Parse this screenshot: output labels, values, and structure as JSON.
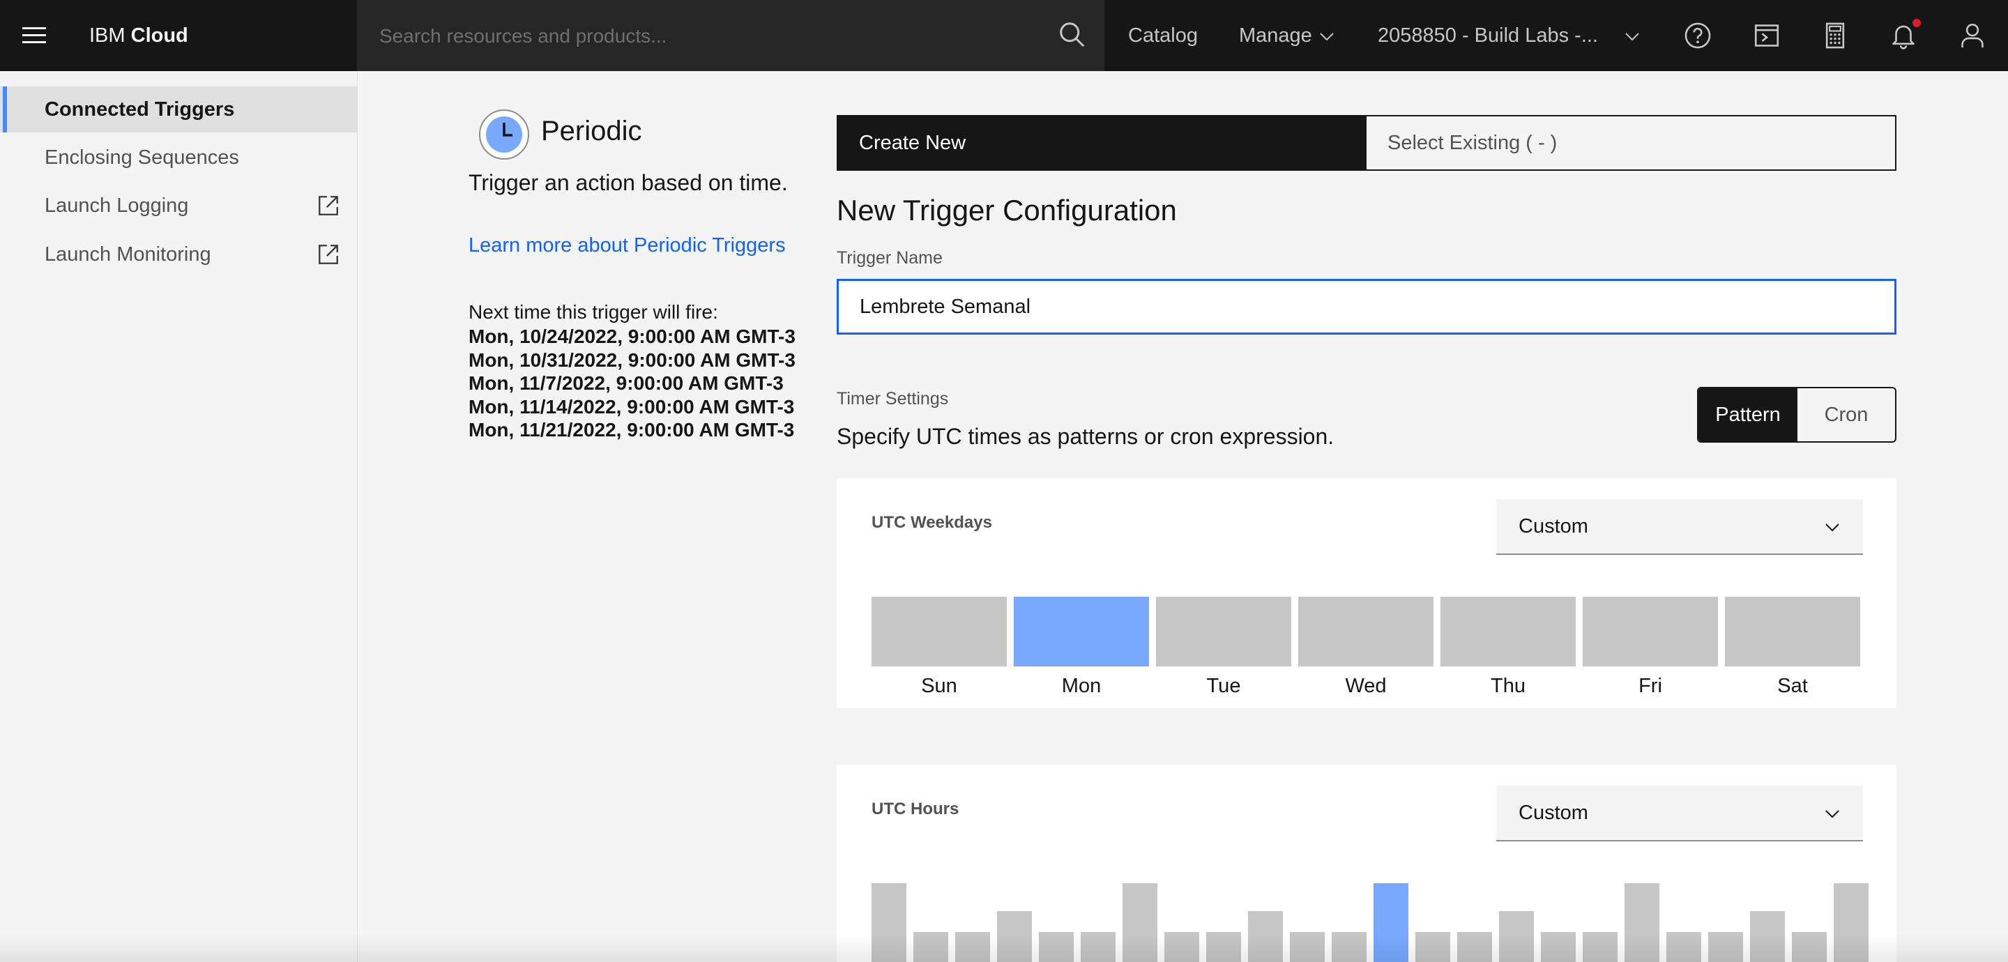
{
  "header": {
    "brand_prefix": "IBM",
    "brand_name": "Cloud",
    "search_placeholder": "Search resources and products...",
    "catalog_label": "Catalog",
    "manage_label": "Manage",
    "account_label": "2058850 - Build Labs -...",
    "icons": [
      "menu-icon",
      "search-icon",
      "chevron-down-icon",
      "help-icon",
      "cloud-shell-icon",
      "cost-estimator-icon",
      "notification-icon",
      "user-icon"
    ]
  },
  "sidebar": {
    "items": [
      {
        "label": "Connected Triggers",
        "active": true
      },
      {
        "label": "Enclosing Sequences"
      },
      {
        "label": "Launch Logging",
        "icon": "launch-icon"
      },
      {
        "label": "Launch Monitoring",
        "icon": "launch-icon"
      }
    ]
  },
  "trigger_info": {
    "title": "Periodic",
    "description": "Trigger an action based on time.",
    "learn_more": "Learn more about Periodic Triggers",
    "next_fire_label": "Next time this trigger will fire:",
    "next_fire_times": [
      "Mon, 10/24/2022, 9:00:00 AM GMT-3",
      "Mon, 10/31/2022, 9:00:00 AM GMT-3",
      "Mon, 11/7/2022, 9:00:00 AM GMT-3",
      "Mon, 11/14/2022, 9:00:00 AM GMT-3",
      "Mon, 11/21/2022, 9:00:00 AM GMT-3"
    ]
  },
  "config": {
    "tabs": [
      "Create New",
      "Select Existing ( - )"
    ],
    "section_title": "New Trigger Configuration",
    "name_label": "Trigger Name",
    "name_value": "Lembrete Semanal",
    "timer_label": "Timer Settings",
    "timer_description": "Specify UTC times as patterns or cron expression.",
    "mode_options": [
      "Pattern",
      "Cron"
    ],
    "mode_selected": "Pattern",
    "weekdays": {
      "title": "UTC Weekdays",
      "dropdown_value": "Custom",
      "days": [
        "Sun",
        "Mon",
        "Tue",
        "Wed",
        "Thu",
        "Fri",
        "Sat"
      ],
      "selected": [
        "Mon"
      ]
    },
    "hours": {
      "title": "UTC Hours",
      "dropdown_value": "Custom",
      "selected_hour": 12
    }
  },
  "colors": {
    "accent": "#0f62fe",
    "selected": "#78a9ff",
    "unselected": "#c6c6c6",
    "header_bg": "#161616"
  }
}
